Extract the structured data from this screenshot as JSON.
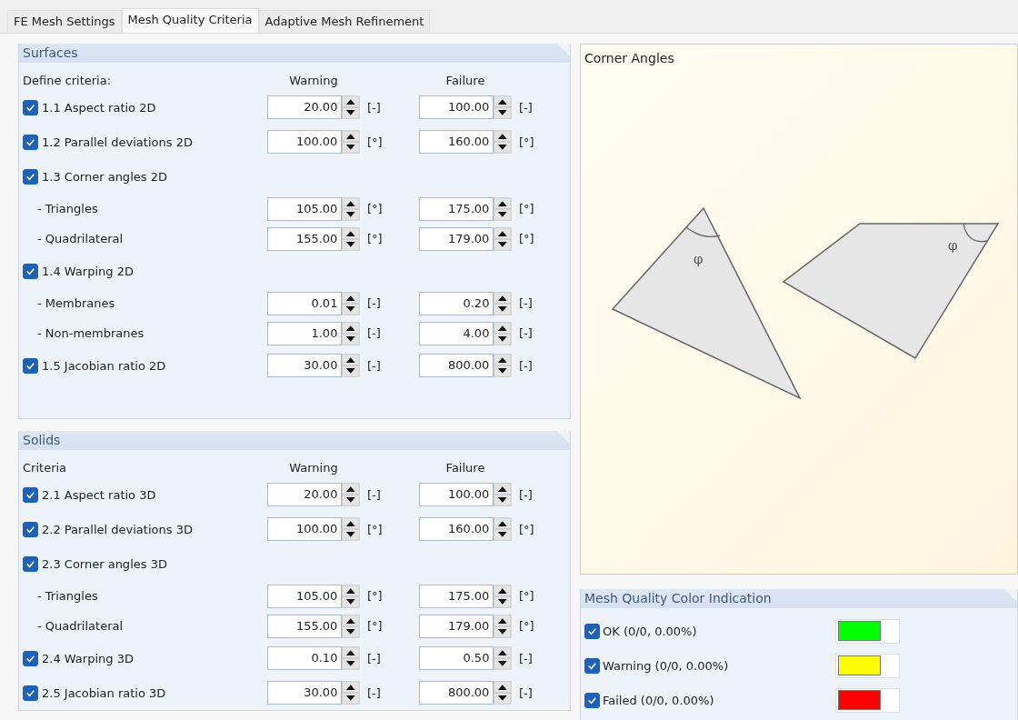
{
  "tabs": [
    {
      "label": "FE Mesh Settings",
      "selected": false
    },
    {
      "label": "Mesh Quality Criteria",
      "selected": true
    },
    {
      "label": "Adaptive Mesh Refinement",
      "selected": false
    }
  ],
  "surfaces": {
    "title": "Surfaces",
    "criteria_label": "Define criteria:",
    "warning_header": "Warning",
    "failure_header": "Failure",
    "rows": [
      {
        "kind": "criterion",
        "label": "1.1 Aspect ratio 2D",
        "checked": true,
        "warning": "20.00",
        "warning_unit": "[-]",
        "failure": "100.00",
        "failure_unit": "[-]"
      },
      {
        "kind": "criterion",
        "label": "1.2 Parallel deviations 2D",
        "checked": true,
        "warning": "100.00",
        "warning_unit": "[°]",
        "failure": "160.00",
        "failure_unit": "[°]"
      },
      {
        "kind": "group",
        "label": "1.3 Corner angles 2D",
        "checked": true
      },
      {
        "kind": "sub",
        "label": "- Triangles",
        "warning": "105.00",
        "warning_unit": "[°]",
        "failure": "175.00",
        "failure_unit": "[°]"
      },
      {
        "kind": "sub",
        "label": "- Quadrilateral",
        "warning": "155.00",
        "warning_unit": "[°]",
        "failure": "179.00",
        "failure_unit": "[°]"
      },
      {
        "kind": "group",
        "label": "1.4 Warping 2D",
        "checked": true
      },
      {
        "kind": "sub",
        "label": "- Membranes",
        "warning": "0.01",
        "warning_unit": "[-]",
        "failure": "0.20",
        "failure_unit": "[-]"
      },
      {
        "kind": "sub",
        "label": "- Non-membranes",
        "warning": "1.00",
        "warning_unit": "[-]",
        "failure": "4.00",
        "failure_unit": "[-]"
      },
      {
        "kind": "criterion",
        "label": "1.5 Jacobian ratio 2D",
        "checked": true,
        "warning": "30.00",
        "warning_unit": "[-]",
        "failure": "800.00",
        "failure_unit": "[-]"
      }
    ]
  },
  "solids": {
    "title": "Solids",
    "criteria_label": "Criteria",
    "warning_header": "Warning",
    "failure_header": "Failure",
    "rows": [
      {
        "kind": "criterion",
        "label": "2.1 Aspect ratio 3D",
        "checked": true,
        "warning": "20.00",
        "warning_unit": "[-]",
        "failure": "100.00",
        "failure_unit": "[-]"
      },
      {
        "kind": "criterion",
        "label": "2.2 Parallel deviations 3D",
        "checked": true,
        "warning": "100.00",
        "warning_unit": "[°]",
        "failure": "160.00",
        "failure_unit": "[°]"
      },
      {
        "kind": "group",
        "label": "2.3 Corner angles 3D",
        "checked": true
      },
      {
        "kind": "sub",
        "label": "- Triangles",
        "warning": "105.00",
        "warning_unit": "[°]",
        "failure": "175.00",
        "failure_unit": "[°]"
      },
      {
        "kind": "sub",
        "label": "- Quadrilateral",
        "warning": "155.00",
        "warning_unit": "[°]",
        "failure": "179.00",
        "failure_unit": "[°]"
      },
      {
        "kind": "criterion",
        "label": "2.4 Warping 3D",
        "checked": true,
        "warning": "0.10",
        "warning_unit": "[-]",
        "failure": "0.50",
        "failure_unit": "[-]"
      },
      {
        "kind": "criterion",
        "label": "2.5 Jacobian ratio 3D",
        "checked": true,
        "warning": "30.00",
        "warning_unit": "[-]",
        "failure": "800.00",
        "failure_unit": "[-]"
      }
    ]
  },
  "diagram": {
    "title": "Corner Angles",
    "angle_labels": [
      "φ",
      "φ"
    ]
  },
  "color_indication": {
    "title": "Mesh Quality Color Indication",
    "items": [
      {
        "label": "OK (0/0, 0.00%)",
        "checked": true,
        "color": "#00ff00"
      },
      {
        "label": "Warning (0/0, 0.00%)",
        "checked": true,
        "color": "#ffff00"
      },
      {
        "label": "Failed (0/0, 0.00%)",
        "checked": true,
        "color": "#ff0000"
      }
    ]
  }
}
